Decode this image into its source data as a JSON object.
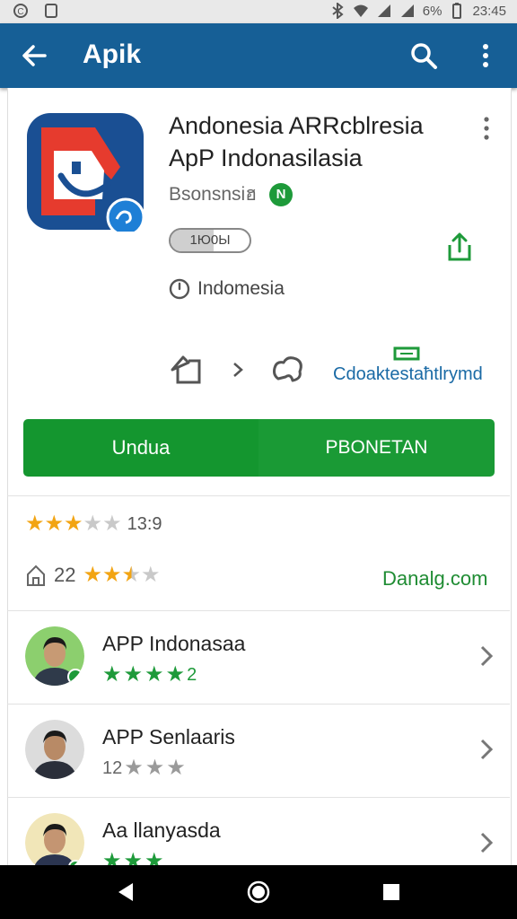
{
  "status_bar": {
    "left_icons": [
      "notification-circle-icon",
      "app-notification-icon"
    ],
    "right_icons": [
      "bluetooth-icon",
      "wifi-icon",
      "signal-icon",
      "signal-icon",
      "battery-icon"
    ],
    "battery": "6%",
    "time": "23:45"
  },
  "app_bar": {
    "title": "Apik",
    "bg_color": "#165f96",
    "icons": {
      "back": "arrow-left-icon",
      "search": "search-icon",
      "menu": "more-vertical-icon"
    }
  },
  "app": {
    "name": "Andonesia ARRcblresia ApP Indonasilasia",
    "developer": "Bsonsnsiฮ",
    "verified_badge": "N",
    "badge_label": "1Ю0Ы",
    "badge_progress": 0.55,
    "region": "Indomesia"
  },
  "actions": {
    "label": "Cdoaktestaħtlrymd",
    "icons": [
      "install-icon",
      "chevron-right-icon",
      "cloud-icon",
      "message-icon"
    ]
  },
  "buttons": {
    "install": "Undua",
    "open": "PBONETAN",
    "accent": "#14962f"
  },
  "ratings": {
    "summary_stars": 3,
    "summary_count": "13:9",
    "downloads_value": "22",
    "secondary_stars": 2.5,
    "website": "Danalg.com"
  },
  "reviews": [
    {
      "name": "APP Indonasaa",
      "stars": 4,
      "stars_color": "green",
      "suffix": "2"
    },
    {
      "name": "APP Senlaaris",
      "stars": 3,
      "stars_color": "grey",
      "prefix": "12"
    },
    {
      "name": "Aa Ɩlanyasda",
      "stars": 3,
      "stars_color": "green"
    }
  ],
  "nav": {
    "icons": [
      "back-triangle-icon",
      "home-circle-icon",
      "recents-square-icon"
    ]
  }
}
